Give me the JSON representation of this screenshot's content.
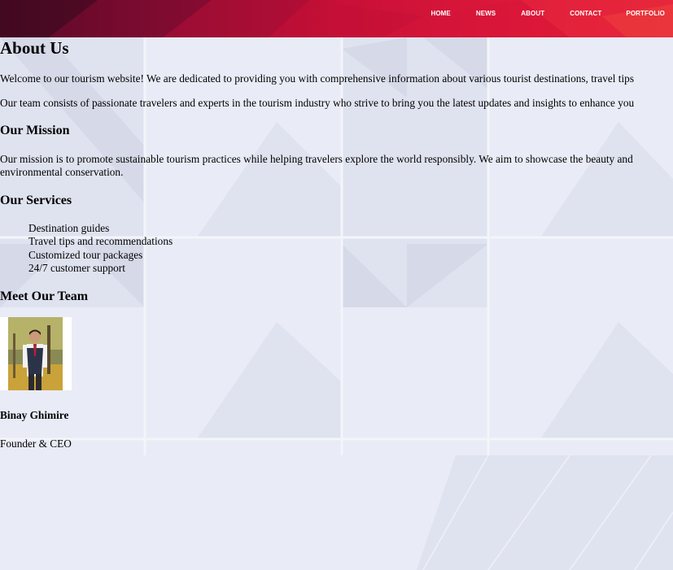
{
  "nav": {
    "items": [
      {
        "label": "HOME"
      },
      {
        "label": "NEWS"
      },
      {
        "label": "ABOUT"
      },
      {
        "label": "CONTACT"
      },
      {
        "label": "PORTFOLIO"
      }
    ]
  },
  "about": {
    "title": "About Us",
    "intro": "Welcome to our tourism website! We are dedicated to providing you with comprehensive information about various tourist destinations, travel tips",
    "team_text": "Our team consists of passionate travelers and experts in the tourism industry who strive to bring you the latest updates and insights to enhance you"
  },
  "mission": {
    "heading": "Our Mission",
    "line1": "Our mission is to promote sustainable tourism practices while helping travelers explore the world responsibly. We aim to showcase the beauty and",
    "line2": "environmental conservation."
  },
  "services": {
    "heading": "Our Services",
    "items": [
      "Destination guides",
      "Travel tips and recommendations",
      "Customized tour packages",
      "24/7 customer support"
    ]
  },
  "team": {
    "heading": "Meet Our Team",
    "members": [
      {
        "name": "Binay Ghimire",
        "role": "Founder & CEO",
        "photo_icon": "person-photo"
      }
    ]
  },
  "colors": {
    "header_start": "#4a0a22",
    "header_end": "#e8263a",
    "page_background": "#e9ecf6"
  }
}
